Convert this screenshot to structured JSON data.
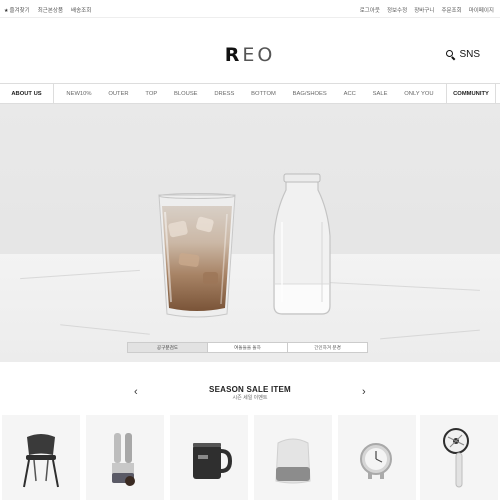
{
  "topbar": {
    "left_links": [
      "즐겨찾기",
      "최근본상품",
      "배송조회"
    ],
    "right_links": [
      "로그아웃",
      "정보수정",
      "장바구니",
      "주문조회",
      "마이페이지"
    ]
  },
  "header": {
    "logo_r": "R",
    "logo_rest": "EO",
    "sns_label": "SNS"
  },
  "nav": {
    "about": "ABOUT US",
    "items": [
      "NEW10%",
      "OUTER",
      "TOP",
      "BLOUSE",
      "DRESS",
      "BOTTOM",
      "BAG/SHOES",
      "ACC",
      "SALE",
      "ONLY YOU"
    ],
    "community": "COMMUNITY"
  },
  "hero": {
    "slider_tabs": [
      "공구분검도",
      "여돌들을 돌하",
      "긴인하겨 분경"
    ],
    "active_tab": 0
  },
  "season": {
    "title": "SEASON SALE ITEM",
    "subtitle": "시즌 세일 이벤트",
    "prev_arrow": "‹",
    "next_arrow": "›"
  },
  "products": [
    {
      "name": "chair-product-image"
    },
    {
      "name": "humidifier-product-image"
    },
    {
      "name": "mug-product-image"
    },
    {
      "name": "smart-speaker-product-image"
    },
    {
      "name": "clock-product-image"
    },
    {
      "name": "fan-product-image"
    }
  ]
}
